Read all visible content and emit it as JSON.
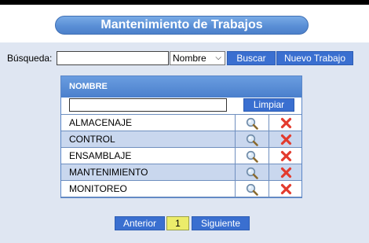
{
  "header": {
    "title": "Mantenimiento de Trabajos"
  },
  "search": {
    "label": "Búsqueda:",
    "value": "",
    "field_selected": "Nombre",
    "buscar_label": "Buscar",
    "nuevo_label": "Nuevo Trabajo"
  },
  "grid": {
    "column_header": "NOMBRE",
    "filter_value": "",
    "limpiar_label": "Limpiar",
    "rows": [
      {
        "name": "ALMACENAJE"
      },
      {
        "name": "CONTROL"
      },
      {
        "name": "ENSAMBLAJE"
      },
      {
        "name": "MANTENIMIENTO"
      },
      {
        "name": "MONITOREO"
      }
    ]
  },
  "pagination": {
    "prev_label": "Anterior",
    "current_page": "1",
    "next_label": "Siguiente"
  },
  "colors": {
    "accent": "#3a6fd0",
    "page_background": "#dfe6f2",
    "alt_row": "#c9d7ee",
    "current_page_bg": "#ecec6a",
    "delete_icon": "#e33b2e"
  },
  "icons": {
    "view": "magnifier-icon",
    "delete": "red-x-icon"
  }
}
